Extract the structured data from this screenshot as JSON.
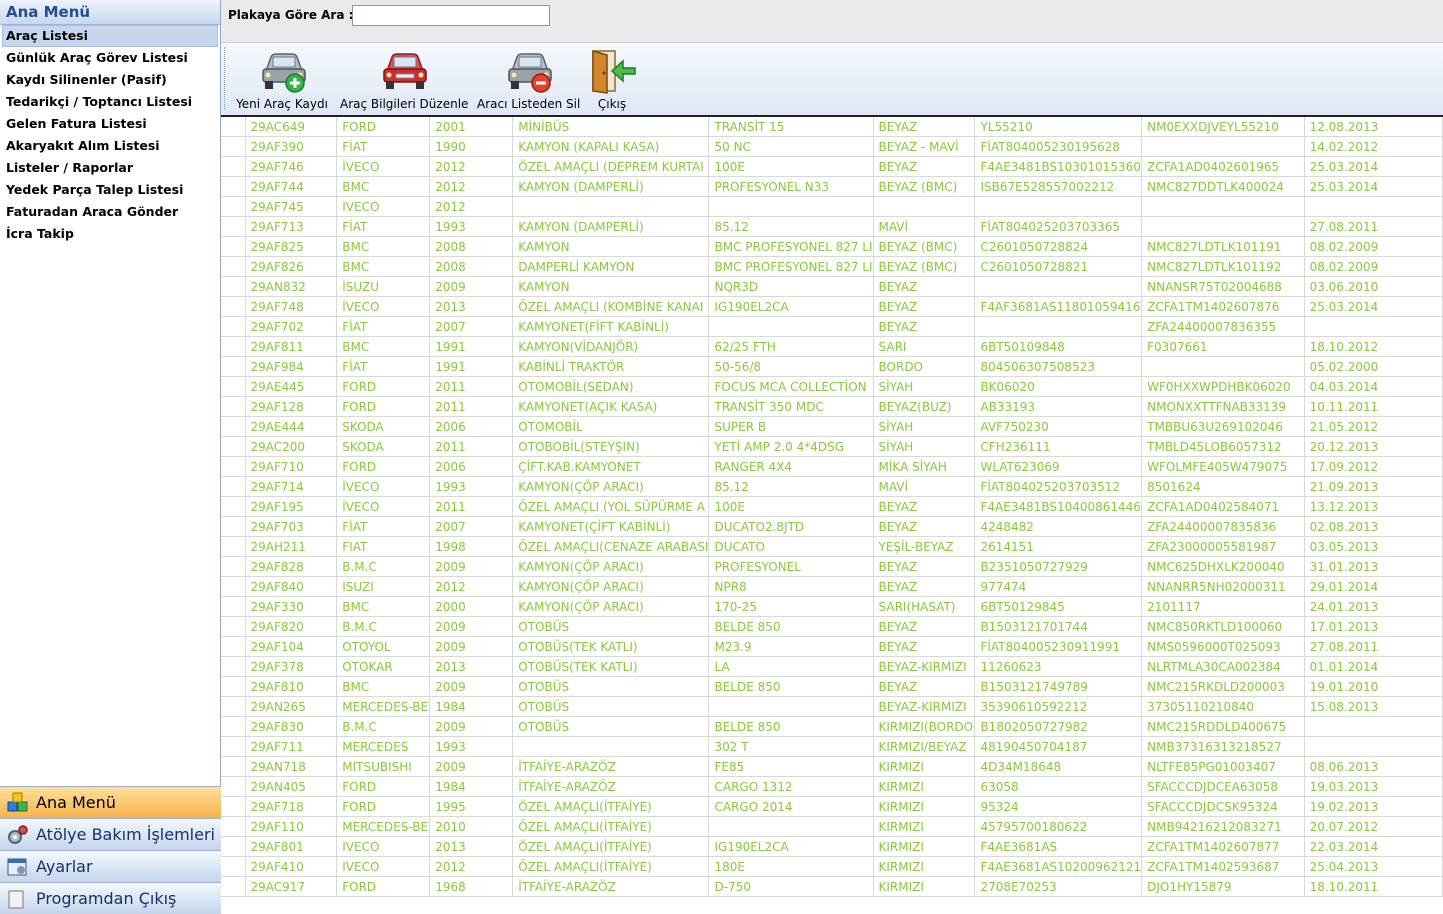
{
  "sidebar": {
    "title": "Ana Menü",
    "items": [
      "Araç Listesi",
      "Günlük Araç Görev Listesi",
      "Kaydı Silinenler (Pasif)",
      "Tedarikçi / Toptancı Listesi",
      "Gelen Fatura Listesi",
      "Akaryakıt Alım Listesi",
      "Listeler / Raporlar",
      "Yedek Parça Talep Listesi",
      "Faturadan Araca Gönder",
      "İcra Takip"
    ],
    "groups": [
      "Ana Menü",
      "Atölye Bakım İşlemleri",
      "Ayarlar",
      "Programdan Çıkış"
    ]
  },
  "search": {
    "label": "Plakaya Göre Ara :",
    "value": ""
  },
  "toolbar": {
    "new_label": "Yeni Araç Kaydı",
    "edit_label": "Araç Bilgileri Düzenle",
    "delete_label": "Aracı Listeden Sil",
    "exit_label": "Çıkış"
  },
  "colors": {
    "row_text": "#8cc63f",
    "active_group": "#f7b34b"
  },
  "grid": {
    "rows": [
      [
        "29AC649",
        "FORD",
        "2001",
        "MİNİBÜS",
        "TRANSİT 15",
        "BEYAZ",
        "YL55210",
        "NM0EXXDJVEYL55210",
        "12.08.2013"
      ],
      [
        "29AF390",
        "FİAT",
        "1990",
        "KAMYON (KAPALI KASA)",
        "50 NC",
        "BEYAZ - MAVİ",
        "FİAT804005230195628",
        "",
        "14.02.2012"
      ],
      [
        "29AF746",
        "İVECO",
        "2012",
        "ÖZEL AMAÇLI (DEPREM KURTAI",
        "100E",
        "BEYAZ",
        "F4AE3481BS10301015360",
        "ZCFA1AD0402601965",
        "25.03.2014"
      ],
      [
        "29AF744",
        "BMC",
        "2012",
        "KAMYON (DAMPERLİ)",
        "PROFESYONEL N33",
        "BEYAZ (BMC)",
        "ISB67E528557002212",
        "NMC827DDTLK400024",
        "25.03.2014"
      ],
      [
        "29AF745",
        "IVECO",
        "2012",
        "",
        "",
        "",
        "",
        "",
        ""
      ],
      [
        "29AF713",
        "FİAT",
        "1993",
        "KAMYON (DAMPERLİ)",
        "85.12",
        "MAVİ",
        "FİAT804025203703365",
        "",
        "27.08.2011"
      ],
      [
        "29AF825",
        "BMC",
        "2008",
        "KAMYON",
        "BMC PROFESYONEL 827 LI",
        "BEYAZ (BMC)",
        "C2601050728824",
        "NMC827LDTLK101191",
        "08.02.2009"
      ],
      [
        "29AF826",
        "BMC",
        "2008",
        "DAMPERLİ KAMYON",
        "BMC PROFESYONEL 827 LI",
        "BEYAZ (BMC)",
        "C2601050728821",
        "NMC827LDTLK101192",
        "08.02.2009"
      ],
      [
        "29AN832",
        "İSUZU",
        "2009",
        "KAMYON",
        "NQR3D",
        "BEYAZ",
        "",
        "NNANSR75T02004688",
        "03.06.2010"
      ],
      [
        "29AF748",
        "İVECO",
        "2013",
        "ÖZEL AMAÇLI (KOMBİNE KANAI",
        "IG190EL2CA",
        "BEYAZ",
        "F4AF3681AS11801059416",
        "ZCFA1TM1402607876",
        "25.03.2014"
      ],
      [
        "29AF702",
        "FİAT",
        "2007",
        "KAMYONET(FİFT KABİNLİ)",
        "",
        "BEYAZ",
        "",
        "ZFA24400007836355",
        ""
      ],
      [
        "29AF811",
        "BMC",
        "1991",
        "KAMYON(VİDANJÖR)",
        "62/25 FTH",
        "SARI",
        "6BT50109848",
        "F0307661",
        "18.10.2012"
      ],
      [
        "29AF984",
        "FİAT",
        "1991",
        "KABİNLİ TRAKTÖR",
        "50-56/8",
        "BORDO",
        "804506307508523",
        "",
        "05.02.2000"
      ],
      [
        "29AE445",
        "FORD",
        "2011",
        "OTOMOBİL(SEDAN)",
        "FOCUS MCA COLLECTİON",
        "SİYAH",
        "BK06020",
        "WF0HXXWPDHBK06020",
        "04.03.2014"
      ],
      [
        "29AF128",
        "FORD",
        "2011",
        "KAMYONET(AÇIK KASA)",
        "TRANSİT 350 MDC",
        "BEYAZ(BUZ)",
        "AB33193",
        "NMONXXTTFNAB33139",
        "10.11.2011"
      ],
      [
        "29AE444",
        "SKODA",
        "2006",
        "OTOMOBİL",
        "SUPER B",
        "SİYAH",
        "AVF750230",
        "TMBBU63U269102046",
        "21.05.2012"
      ],
      [
        "29AC200",
        "SKODA",
        "2011",
        "OTOBOBİL(STEYŞIN)",
        "YETİ AMP 2.0 4*4DSG",
        "SİYAH",
        "CFH236111",
        "TMBLD45LOB6057312",
        "20.12.2013"
      ],
      [
        "29AF710",
        "FORD",
        "2006",
        "ÇİFT.KAB.KAMYONET",
        "RANGER 4X4",
        "MİKA SİYAH",
        "WLAT623069",
        "WFOLMFE405W479075",
        "17.09.2012"
      ],
      [
        "29AF714",
        "İVECO",
        "1993",
        "KAMYON(ÇÖP ARACI)",
        "85.12",
        "MAVİ",
        "FİAT804025203703512",
        "8501624",
        "21.09.2013"
      ],
      [
        "29AF195",
        "İVECO",
        "2011",
        "ÖZEL AMAÇLI (YOL SÜPÜRME A",
        "100E",
        "BEYAZ",
        "F4AE3481BS10400861446",
        "ZCFA1AD0402584071",
        "13.12.2013"
      ],
      [
        "29AF703",
        "FİAT",
        "2007",
        "KAMYONET(ÇİFT KABİNLİ)",
        "DUCATO2.8JTD",
        "BEYAZ",
        "4248482",
        "ZFA24400007835836",
        "02.08.2013"
      ],
      [
        "29AH211",
        "FIAT",
        "1998",
        "ÖZEL AMAÇLI(CENAZE ARABASI",
        "DUCATO",
        "YEŞİL-BEYAZ",
        "2614151",
        "ZFA23000005581987",
        "03.05.2013"
      ],
      [
        "29AF828",
        "B.M.C",
        "2009",
        "KAMYON(ÇÖP ARACI)",
        "PROFESYONEL",
        "BEYAZ",
        "B2351050727929",
        "NMC625DHXLK200040",
        "31.01.2013"
      ],
      [
        "29AF840",
        "ISUZI",
        "2012",
        "KAMYON(ÇÖP ARACI)",
        "NPR8",
        "BEYAZ",
        "977474",
        "NNANRR5NH02000311",
        "29.01.2014"
      ],
      [
        "29AF330",
        "BMC",
        "2000",
        "KAMYON(ÇÖP ARACI)",
        "170-25",
        "SARI(HASAT)",
        "6BT50129845",
        "2101117",
        "24.01.2013"
      ],
      [
        "29AF820",
        "B.M.C",
        "2009",
        "OTOBÜS",
        "BELDE 850",
        "BEYAZ",
        "B1503121701744",
        "NMC850RKTLD100060",
        "17.01.2013"
      ],
      [
        "29AF104",
        "OTOYOL",
        "2009",
        "OTOBÜS(TEK KATLI)",
        "M23.9",
        "BEYAZ",
        "FİAT804005230911991",
        "NMS0596000T025093",
        "27.08.2011"
      ],
      [
        "29AF378",
        "OTOKAR",
        "2013",
        "OTOBÜS(TEK KATLI)",
        "LA",
        "BEYAZ-KIRMIZI",
        "11260623",
        "NLRTMLA30CA002384",
        "01.01.2014"
      ],
      [
        "29AF810",
        "BMC",
        "2009",
        "OTOBÜS",
        "BELDE 850",
        "BEYAZ",
        "B1503121749789",
        "NMC215RKDLD200003",
        "19.01.2010"
      ],
      [
        "29AN265",
        "MERCEDES-BE",
        "1984",
        "OTOBÜS",
        "",
        "BEYAZ-KIRMIZI",
        "35390610592212",
        "37305110210840",
        "15.08.2013"
      ],
      [
        "29AF830",
        "B.M.C",
        "2009",
        "OTOBÜS",
        "BELDE 850",
        "KIRMIZI(BORDO",
        "B1802050727982",
        "NMC215RDDLD400675",
        ""
      ],
      [
        "29AF711",
        "MERCEDES",
        "1993",
        "",
        "302 T",
        "KIRMIZI/BEYAZ",
        "48190450704187",
        "NMB37316313218527",
        ""
      ],
      [
        "29AN718",
        "MITSUBISHI",
        "2009",
        "İTFAİYE-ARAZÖZ",
        "FE85",
        "KIRMIZI",
        "4D34M18648",
        "NLTFE85PG01003407",
        "08.06.2013"
      ],
      [
        "29AN405",
        "FORD",
        "1984",
        "İTFAİYE-ARAZÖZ",
        "CARGO 1312",
        "KIRMIZI",
        "63058",
        "SFACCCDJDCEA63058",
        "19.03.2013"
      ],
      [
        "29AF718",
        "FORD",
        "1995",
        "ÖZEL AMAÇLI(İTFAİYE)",
        "CARGO 2014",
        "KIRMIZI",
        "95324",
        "SFACCCDJDCSK95324",
        "19.02.2013"
      ],
      [
        "29AF110",
        "MERCEDES-BE",
        "2010",
        "ÖZEL AMAÇLI(İTFAİYE)",
        "",
        "KIRMIZI",
        "45795700180622",
        "NMB94216212083271",
        "20.07.2012"
      ],
      [
        "29AF801",
        "IVECO",
        "2013",
        "ÖZEL AMAÇLI(İTFAİYE)",
        "IG190EL2CA",
        "KIRMIZI",
        "F4AE3681AS",
        "ZCFA1TM1402607877",
        "22.03.2014"
      ],
      [
        "29AF410",
        "IVECO",
        "2012",
        "ÖZEL AMAÇLI(İTFAİYE)",
        "180E",
        "KIRMIZI",
        "F4AE3681AS10200962121",
        "ZCFA1TM1402593687",
        "25.04.2013"
      ],
      [
        "29AC917",
        "FORD",
        "1968",
        "İTFAİYE-ARAZÖZ",
        "D-750",
        "KIRMIZI",
        "2708E70253",
        "DJO1HY15879",
        "18.10.2011"
      ]
    ]
  }
}
